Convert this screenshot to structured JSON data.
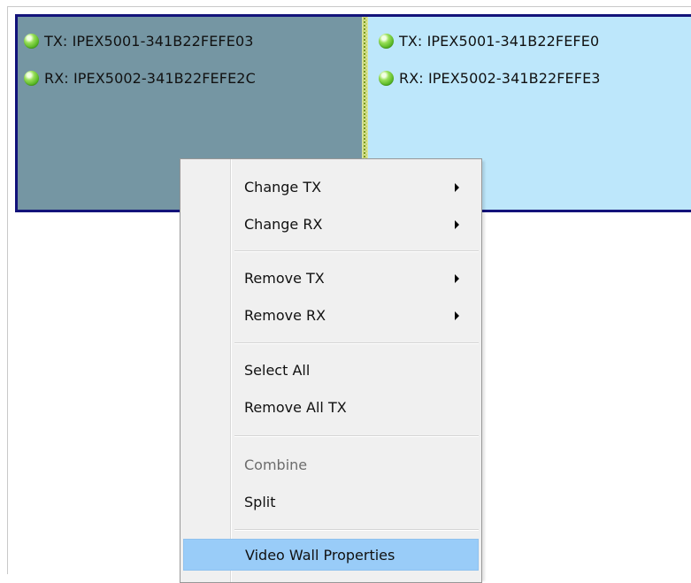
{
  "wall": {
    "displays": [
      {
        "state": "selected",
        "tx": "TX: IPEX5001-341B22FEFE03",
        "rx": "RX: IPEX5002-341B22FEFE2C"
      },
      {
        "state": "normal",
        "tx": "TX: IPEX5001-341B22FEFE0",
        "rx": "RX: IPEX5002-341B22FEFE3"
      }
    ],
    "status_icon": "green-led-icon",
    "colors": {
      "border": "#13137a",
      "selected_fill": "#7596a3",
      "normal_fill": "#bde7fb",
      "divider": "#7a9a1a"
    }
  },
  "context_menu": {
    "items": [
      {
        "label": "Change TX",
        "has_submenu": true,
        "enabled": true
      },
      {
        "label": "Change RX",
        "has_submenu": true,
        "enabled": true
      },
      {
        "label": "Remove TX",
        "has_submenu": true,
        "enabled": true
      },
      {
        "label": "Remove RX",
        "has_submenu": true,
        "enabled": true
      },
      {
        "label": "Select All",
        "has_submenu": false,
        "enabled": true
      },
      {
        "label": "Remove All TX",
        "has_submenu": false,
        "enabled": true
      },
      {
        "label": "Combine",
        "has_submenu": false,
        "enabled": false
      },
      {
        "label": "Split",
        "has_submenu": false,
        "enabled": true
      },
      {
        "label": "Video Wall Properties",
        "has_submenu": false,
        "enabled": true,
        "highlighted": true
      }
    ],
    "highlight_color": "#99ccf8"
  }
}
